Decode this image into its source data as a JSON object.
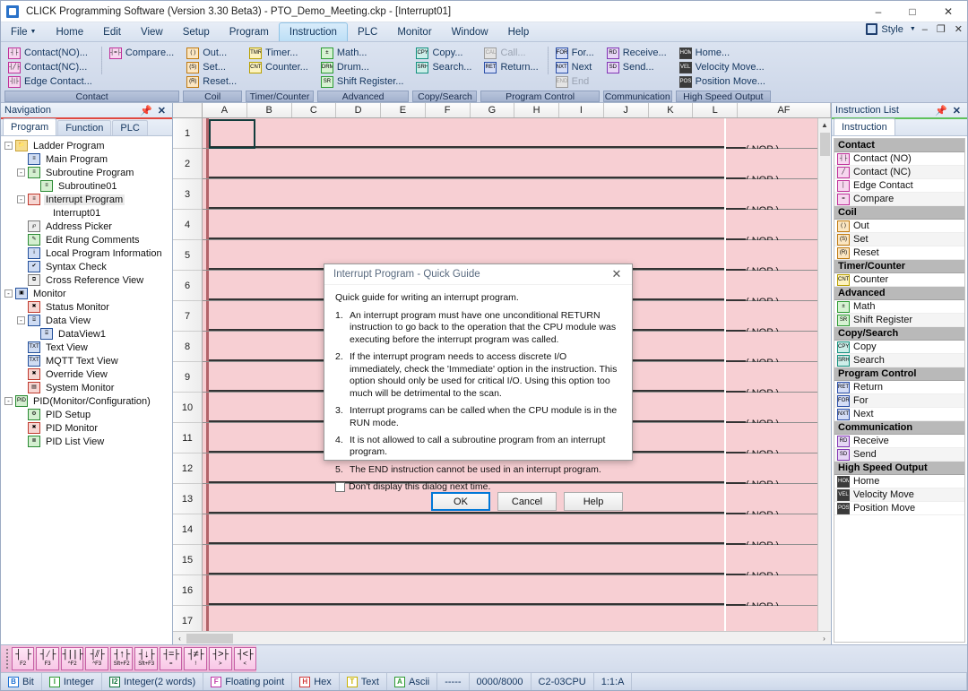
{
  "window": {
    "title": "CLICK Programming Software (Version 3.30 Beta3) - PTO_Demo_Meeting.ckp -  [Interrupt01]",
    "minimize": "–",
    "maximize": "□",
    "close": "✕"
  },
  "menu": {
    "items": [
      {
        "label": "File",
        "caret": "▼",
        "active": false
      },
      {
        "label": "Home",
        "active": false
      },
      {
        "label": "Edit",
        "active": false
      },
      {
        "label": "View",
        "active": false
      },
      {
        "label": "Setup",
        "active": false
      },
      {
        "label": "Program",
        "active": false
      },
      {
        "label": "Instruction",
        "active": true
      },
      {
        "label": "PLC",
        "active": false
      },
      {
        "label": "Monitor",
        "active": false
      },
      {
        "label": "Window",
        "active": false
      },
      {
        "label": "Help",
        "active": false
      }
    ],
    "style_label": "Style",
    "style_caret": "▼",
    "doc_minimize": "–",
    "doc_restore": "❐",
    "doc_close": "✕"
  },
  "ribbon": {
    "groups": [
      {
        "label": "Contact",
        "columns": [
          [
            {
              "label": "Contact(NO)...",
              "icon": "contact-no-icon",
              "glyph": "┤├",
              "color": "pink"
            },
            {
              "label": "Contact(NC)...",
              "icon": "contact-nc-icon",
              "glyph": "┤╱├",
              "color": "pink"
            },
            {
              "label": "Edge Contact...",
              "icon": "edge-contact-icon",
              "glyph": "┤|├",
              "color": "pink"
            }
          ],
          [
            {
              "label": "Compare...",
              "icon": "compare-icon",
              "glyph": "┤=├",
              "color": "pink"
            }
          ]
        ]
      },
      {
        "label": "Coil",
        "columns": [
          [
            {
              "label": "Out...",
              "icon": "out-coil-icon",
              "glyph": "( )",
              "color": "orange"
            },
            {
              "label": "Set...",
              "icon": "set-coil-icon",
              "glyph": "(S)",
              "color": "orange"
            },
            {
              "label": "Reset...",
              "icon": "reset-coil-icon",
              "glyph": "(R)",
              "color": "orange"
            }
          ]
        ]
      },
      {
        "label": "Timer/Counter",
        "columns": [
          [
            {
              "label": "Timer...",
              "icon": "timer-icon",
              "glyph": "TMR",
              "color": "yellow"
            },
            {
              "label": "Counter...",
              "icon": "counter-icon",
              "glyph": "CNT",
              "color": "yellow"
            }
          ]
        ]
      },
      {
        "label": "Advanced",
        "columns": [
          [
            {
              "label": "Math...",
              "icon": "math-icon",
              "glyph": "±",
              "color": "green"
            },
            {
              "label": "Drum...",
              "icon": "drum-icon",
              "glyph": "DRM",
              "color": "green"
            },
            {
              "label": "Shift Register...",
              "icon": "shift-register-icon",
              "glyph": "SR",
              "color": "green"
            }
          ]
        ]
      },
      {
        "label": "Copy/Search",
        "columns": [
          [
            {
              "label": "Copy...",
              "icon": "copy-icon",
              "glyph": "CPY",
              "color": "teal"
            },
            {
              "label": "Search...",
              "icon": "search-icon",
              "glyph": "SRH",
              "color": "teal"
            }
          ]
        ]
      },
      {
        "label": "Program Control",
        "columns": [
          [
            {
              "label": "Call...",
              "icon": "call-icon",
              "glyph": "CAL",
              "color": "gray",
              "disabled": true
            },
            {
              "label": "Return...",
              "icon": "return-icon",
              "glyph": "RET",
              "color": "blue"
            }
          ],
          [
            {
              "label": "For...",
              "icon": "for-icon",
              "glyph": "FOR",
              "color": "blue"
            },
            {
              "label": "Next",
              "icon": "next-icon",
              "glyph": "NXT",
              "color": "blue"
            },
            {
              "label": "End",
              "icon": "end-icon",
              "glyph": "END",
              "color": "gray",
              "disabled": true
            }
          ]
        ]
      },
      {
        "label": "Communication",
        "columns": [
          [
            {
              "label": "Receive...",
              "icon": "receive-icon",
              "glyph": "RD",
              "color": "purple"
            },
            {
              "label": "Send...",
              "icon": "send-icon",
              "glyph": "SD",
              "color": "purple"
            }
          ]
        ]
      },
      {
        "label": "High Speed Output",
        "columns": [
          [
            {
              "label": "Home...",
              "icon": "home-icon",
              "glyph": "HOME",
              "color": "dark"
            },
            {
              "label": "Velocity Move...",
              "icon": "velocity-move-icon",
              "glyph": "VEL",
              "color": "dark"
            },
            {
              "label": "Position Move...",
              "icon": "position-move-icon",
              "glyph": "POS",
              "color": "dark"
            }
          ]
        ]
      }
    ]
  },
  "navigation": {
    "title": "Navigation",
    "pin": "📌",
    "close": "✕",
    "tabs": [
      {
        "label": "Program",
        "active": true
      },
      {
        "label": "Function",
        "active": false
      },
      {
        "label": "PLC",
        "active": false
      }
    ],
    "tree": [
      {
        "label": "Ladder Program",
        "indent": 0,
        "exp": "-",
        "icon": "folder-icon",
        "glyph": "📁",
        "kind": "folder"
      },
      {
        "label": "Main Program",
        "indent": 1,
        "exp": "",
        "icon": "main-program-icon",
        "glyph": "≡",
        "kind": "blue"
      },
      {
        "label": "Subroutine Program",
        "indent": 1,
        "exp": "-",
        "icon": "subroutine-program-icon",
        "glyph": "≡",
        "kind": "green"
      },
      {
        "label": "Subroutine01",
        "indent": 2,
        "exp": "",
        "icon": "subroutine01-icon",
        "glyph": "≡",
        "kind": "green"
      },
      {
        "label": "Interrupt Program",
        "indent": 1,
        "exp": "-",
        "icon": "interrupt-program-icon",
        "glyph": "≡",
        "kind": "red",
        "selected": true
      },
      {
        "label": "Interrupt01",
        "indent": 2,
        "exp": "",
        "icon": "",
        "glyph": "",
        "kind": "none"
      },
      {
        "label": "Address Picker",
        "indent": 1,
        "exp": "",
        "icon": "address-picker-icon",
        "glyph": "℘",
        "kind": "plain"
      },
      {
        "label": "Edit Rung Comments",
        "indent": 1,
        "exp": "",
        "icon": "edit-rung-comments-icon",
        "glyph": "✎",
        "kind": "green"
      },
      {
        "label": "Local Program Information",
        "indent": 1,
        "exp": "",
        "icon": "local-program-information-icon",
        "glyph": "i",
        "kind": "blue"
      },
      {
        "label": "Syntax Check",
        "indent": 1,
        "exp": "",
        "icon": "syntax-check-icon",
        "glyph": "✔",
        "kind": "blue"
      },
      {
        "label": "Cross Reference View",
        "indent": 1,
        "exp": "",
        "icon": "cross-reference-view-icon",
        "glyph": "⧉",
        "kind": "plain"
      },
      {
        "label": "Monitor",
        "indent": 0,
        "exp": "-",
        "icon": "monitor-icon",
        "glyph": "▣",
        "kind": "blue"
      },
      {
        "label": "Status Monitor",
        "indent": 1,
        "exp": "",
        "icon": "status-monitor-icon",
        "glyph": "✖",
        "kind": "red"
      },
      {
        "label": "Data View",
        "indent": 1,
        "exp": "-",
        "icon": "data-view-icon",
        "glyph": "⌸",
        "kind": "blue"
      },
      {
        "label": "DataView1",
        "indent": 2,
        "exp": "",
        "icon": "dataview1-icon",
        "glyph": "⌸",
        "kind": "blue"
      },
      {
        "label": "Text View",
        "indent": 1,
        "exp": "",
        "icon": "text-view-icon",
        "glyph": "TXT",
        "kind": "blue"
      },
      {
        "label": "MQTT Text View",
        "indent": 1,
        "exp": "",
        "icon": "mqtt-text-view-icon",
        "glyph": "TXT",
        "kind": "blue"
      },
      {
        "label": "Override View",
        "indent": 1,
        "exp": "",
        "icon": "override-view-icon",
        "glyph": "✖",
        "kind": "red"
      },
      {
        "label": "System Monitor",
        "indent": 1,
        "exp": "",
        "icon": "system-monitor-icon",
        "glyph": "▤",
        "kind": "red"
      },
      {
        "label": "PID(Monitor/Configuration)",
        "indent": 0,
        "exp": "-",
        "icon": "pid-icon",
        "glyph": "PID",
        "kind": "green"
      },
      {
        "label": "PID Setup",
        "indent": 1,
        "exp": "",
        "icon": "pid-setup-icon",
        "glyph": "⚙",
        "kind": "green"
      },
      {
        "label": "PID Monitor",
        "indent": 1,
        "exp": "",
        "icon": "pid-monitor-icon",
        "glyph": "✖",
        "kind": "red"
      },
      {
        "label": "PID List View",
        "indent": 1,
        "exp": "",
        "icon": "pid-list-view-icon",
        "glyph": "≣",
        "kind": "green"
      }
    ]
  },
  "ladder": {
    "columns": [
      "A",
      "B",
      "C",
      "D",
      "E",
      "F",
      "G",
      "H",
      "I",
      "J",
      "K",
      "L"
    ],
    "af_column": "AF",
    "rows": [
      1,
      2,
      3,
      4,
      5,
      6,
      7,
      8,
      9,
      10,
      11,
      12,
      13,
      14,
      15,
      16,
      17
    ],
    "nop_label": "( NOP )",
    "scroll_up": "▲",
    "scroll_down": "▼",
    "scroll_left": "‹",
    "scroll_right": "›"
  },
  "instruction_list": {
    "title": "Instruction List",
    "pin": "📌",
    "close": "✕",
    "tabs": [
      {
        "label": "Instruction",
        "active": true
      }
    ],
    "sections": [
      {
        "group": "Contact",
        "items": [
          {
            "label": "Contact (NO)",
            "icon": "contact-no-icon",
            "glyph": "┤├",
            "color": "pink"
          },
          {
            "label": "Contact (NC)",
            "icon": "contact-nc-icon",
            "glyph": "╱",
            "color": "pink"
          },
          {
            "label": "Edge Contact",
            "icon": "edge-contact-icon",
            "glyph": "│",
            "color": "pink"
          },
          {
            "label": "Compare",
            "icon": "compare-icon",
            "glyph": "=",
            "color": "pink"
          }
        ]
      },
      {
        "group": "Coil",
        "items": [
          {
            "label": "Out",
            "icon": "out-coil-icon",
            "glyph": "( )",
            "color": "orange"
          },
          {
            "label": "Set",
            "icon": "set-coil-icon",
            "glyph": "(S)",
            "color": "orange"
          },
          {
            "label": "Reset",
            "icon": "reset-coil-icon",
            "glyph": "(R)",
            "color": "orange"
          }
        ]
      },
      {
        "group": "Timer/Counter",
        "items": [
          {
            "label": "Counter",
            "icon": "counter-icon",
            "glyph": "CNT",
            "color": "yellow"
          }
        ]
      },
      {
        "group": "Advanced",
        "items": [
          {
            "label": "Math",
            "icon": "math-icon",
            "glyph": "±",
            "color": "green"
          },
          {
            "label": "Shift Register",
            "icon": "shift-register-icon",
            "glyph": "SR",
            "color": "green"
          }
        ]
      },
      {
        "group": "Copy/Search",
        "items": [
          {
            "label": "Copy",
            "icon": "copy-icon",
            "glyph": "CPY",
            "color": "teal"
          },
          {
            "label": "Search",
            "icon": "search-icon",
            "glyph": "SRH",
            "color": "teal"
          }
        ]
      },
      {
        "group": "Program Control",
        "items": [
          {
            "label": "Return",
            "icon": "return-icon",
            "glyph": "RET",
            "color": "blue"
          },
          {
            "label": "For",
            "icon": "for-icon",
            "glyph": "FOR",
            "color": "blue"
          },
          {
            "label": "Next",
            "icon": "next-icon",
            "glyph": "NXT",
            "color": "blue"
          }
        ]
      },
      {
        "group": "Communication",
        "items": [
          {
            "label": "Receive",
            "icon": "receive-icon",
            "glyph": "RD",
            "color": "purple"
          },
          {
            "label": "Send",
            "icon": "send-icon",
            "glyph": "SD",
            "color": "purple"
          }
        ]
      },
      {
        "group": "High Speed Output",
        "items": [
          {
            "label": "Home",
            "icon": "home-icon",
            "glyph": "HOME",
            "color": "dark"
          },
          {
            "label": "Velocity Move",
            "icon": "velocity-move-icon",
            "glyph": "VEL",
            "color": "dark"
          },
          {
            "label": "Position Move",
            "icon": "position-move-icon",
            "glyph": "POS",
            "color": "dark"
          }
        ]
      }
    ]
  },
  "dialog": {
    "title": "Interrupt Program - Quick Guide",
    "close": "✕",
    "lead": "Quick guide for writing an interrupt program.",
    "items": [
      {
        "num": "1.",
        "text": "An interrupt program must have one unconditional RETURN instruction to go back to the operation that the CPU module was executing before the interrupt program was called."
      },
      {
        "num": "2.",
        "text": "If the interrupt program needs to access discrete I/O immediately, check the 'Immediate' option in the instruction. This option should only be used for critical I/O. Using this option too much will be detrimental to the scan."
      },
      {
        "num": "3.",
        "text": "Interrupt programs can be called when the CPU module is in the RUN mode."
      },
      {
        "num": "4.",
        "text": "It is not allowed to call a subroutine program from an interrupt program."
      },
      {
        "num": "5.",
        "text": "The END instruction cannot be used in an interrupt program."
      }
    ],
    "checkbox_label": "Don't display this dialog next time.",
    "checkbox_checked": false,
    "buttons": [
      {
        "label": "OK",
        "default": true
      },
      {
        "label": "Cancel",
        "default": false
      },
      {
        "label": "Help",
        "default": false
      }
    ]
  },
  "contact_toolbar": {
    "buttons": [
      {
        "sym": "┤ ├",
        "key": "F2",
        "name": "contact-no-f2"
      },
      {
        "sym": "┤∕├",
        "key": "F3",
        "name": "contact-nc-f3"
      },
      {
        "sym": "┤||├",
        "key": "^F2",
        "name": "edge-rising-ctrl-f2"
      },
      {
        "sym": "┤⫽├",
        "key": "^F3",
        "name": "edge-falling-ctrl-f3"
      },
      {
        "sym": "┤↑├",
        "key": "Sft+F2",
        "name": "contact-up-shift-f2"
      },
      {
        "sym": "┤↓├",
        "key": "Sft+F3",
        "name": "contact-down-shift-f3"
      },
      {
        "sym": "┤=├",
        "key": "=",
        "name": "compare-equal"
      },
      {
        "sym": "┤≠├",
        "key": "!",
        "name": "compare-not-equal"
      },
      {
        "sym": "┤>├",
        "key": ">",
        "name": "compare-greater"
      },
      {
        "sym": "┤<├",
        "key": "<",
        "name": "compare-less"
      }
    ]
  },
  "status_bar": {
    "types": [
      {
        "label": "Bit",
        "glyph": "B",
        "color": "#1a6fd4"
      },
      {
        "label": "Integer",
        "glyph": "I",
        "color": "#2f9b33"
      },
      {
        "label": "Integer(2 words)",
        "glyph": "I2",
        "color": "#11743b"
      },
      {
        "label": "Floating point",
        "glyph": "F",
        "color": "#c036a8"
      },
      {
        "label": "Hex",
        "glyph": "H",
        "color": "#d23b3b"
      },
      {
        "label": "Text",
        "glyph": "T",
        "color": "#c9b200"
      },
      {
        "label": "Ascii",
        "glyph": "A",
        "color": "#2f9b33"
      }
    ],
    "dashes": "-----",
    "memory": "0000/8000",
    "cpu": "C2-03CPU",
    "position": "1:1:A",
    "extra": ""
  }
}
